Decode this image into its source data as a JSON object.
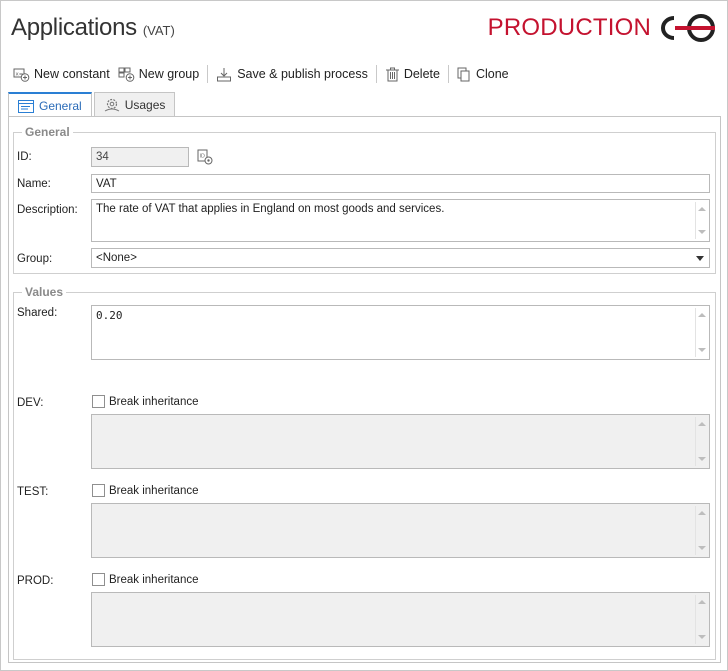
{
  "header": {
    "title": "Applications",
    "subtitle": "(VAT)",
    "environment": "PRODUCTION"
  },
  "toolbar": {
    "new_constant": "New constant",
    "new_group": "New group",
    "save_publish": "Save & publish process",
    "delete": "Delete",
    "clone": "Clone"
  },
  "tabs": {
    "general": "General",
    "usages": "Usages"
  },
  "general": {
    "title": "General",
    "id_label": "ID:",
    "id_value": "34",
    "name_label": "Name:",
    "name_value": "VAT",
    "description_label": "Description:",
    "description_value": "The rate of VAT that applies in England on most goods and services.",
    "group_label": "Group:",
    "group_value": "<None>"
  },
  "values": {
    "title": "Values",
    "shared_label": "Shared:",
    "shared_value": "0.20",
    "dev_label": "DEV:",
    "test_label": "TEST:",
    "prod_label": "PROD:",
    "break_label": "Break inheritance"
  },
  "colors": {
    "environment": "#c4122f",
    "active_tab": "#2a7fd4"
  },
  "icons": [
    "new-constant-icon",
    "new-group-icon",
    "save-publish-icon",
    "delete-icon",
    "clone-icon",
    "general-tab-icon",
    "usages-tab-icon",
    "copy-id-icon",
    "logo-icon"
  ]
}
